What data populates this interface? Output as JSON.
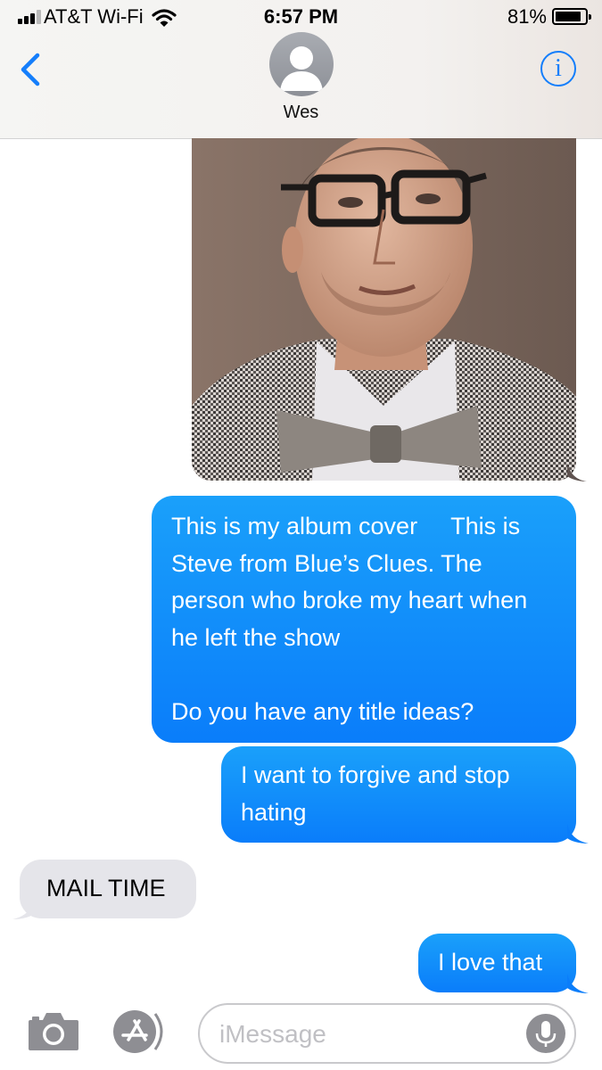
{
  "status_bar": {
    "carrier": "AT&T Wi-Fi",
    "time": "6:57 PM",
    "battery_percent": "81%",
    "battery_level": 0.81,
    "signal_bars_filled": 3,
    "signal_bars_total": 4
  },
  "header": {
    "contact_name": "Wes",
    "back_icon": "chevron-left-icon",
    "info_icon": "info-icon",
    "info_glyph": "i"
  },
  "thread": {
    "photo_description_icon": "photo-attachment",
    "messages": [
      {
        "direction": "sent",
        "text": "This is my album cover     This is Steve from Blue’s Clues. The person who broke my heart when he left the show\n\nDo you have any title ideas?"
      },
      {
        "direction": "sent",
        "text": "I want to forgive and stop hating"
      },
      {
        "direction": "received",
        "text": "MAIL TIME"
      },
      {
        "direction": "sent",
        "text": "I love that"
      }
    ]
  },
  "input_bar": {
    "placeholder": "iMessage",
    "value": "",
    "camera_icon": "camera-icon",
    "apps_icon": "app-store-icon",
    "mic_icon": "microphone-icon"
  },
  "colors": {
    "accent": "#147efb",
    "sent_bubble_top": "#1aa0fa",
    "sent_bubble_bottom": "#0a7dfa",
    "received_bubble": "#e5e5ea",
    "icon_gray": "#8e8e93"
  }
}
